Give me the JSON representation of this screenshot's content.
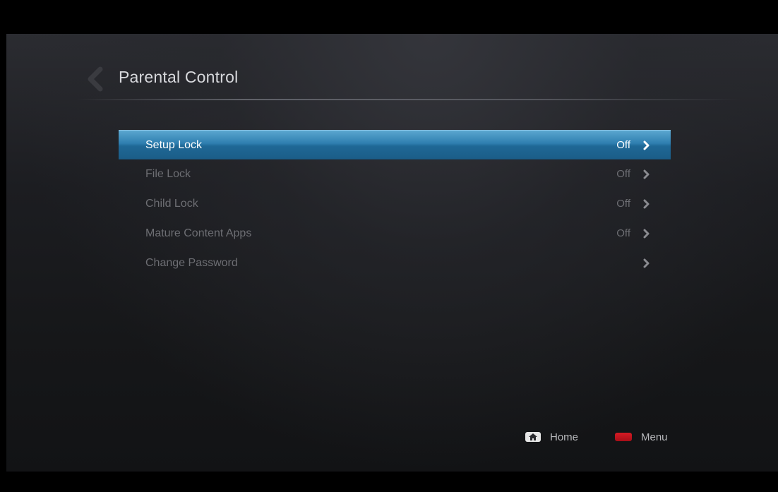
{
  "header": {
    "title": "Parental Control",
    "back_icon": "back-chevron-icon"
  },
  "menu": {
    "items": [
      {
        "label": "Setup Lock",
        "value": "Off",
        "selected": true
      },
      {
        "label": "File Lock",
        "value": "Off",
        "selected": false
      },
      {
        "label": "Child Lock",
        "value": "Off",
        "selected": false
      },
      {
        "label": "Mature Content Apps",
        "value": "Off",
        "selected": false
      },
      {
        "label": "Change Password",
        "value": "",
        "selected": false
      }
    ]
  },
  "footer": {
    "home_label": "Home",
    "menu_label": "Menu",
    "home_icon": "home-key-icon",
    "menu_icon": "red-key-icon"
  },
  "colors": {
    "selection": "#2f7fb0",
    "text_inactive": "#6d6e73",
    "text_active": "#ffffff",
    "red_key": "#d51a24"
  }
}
